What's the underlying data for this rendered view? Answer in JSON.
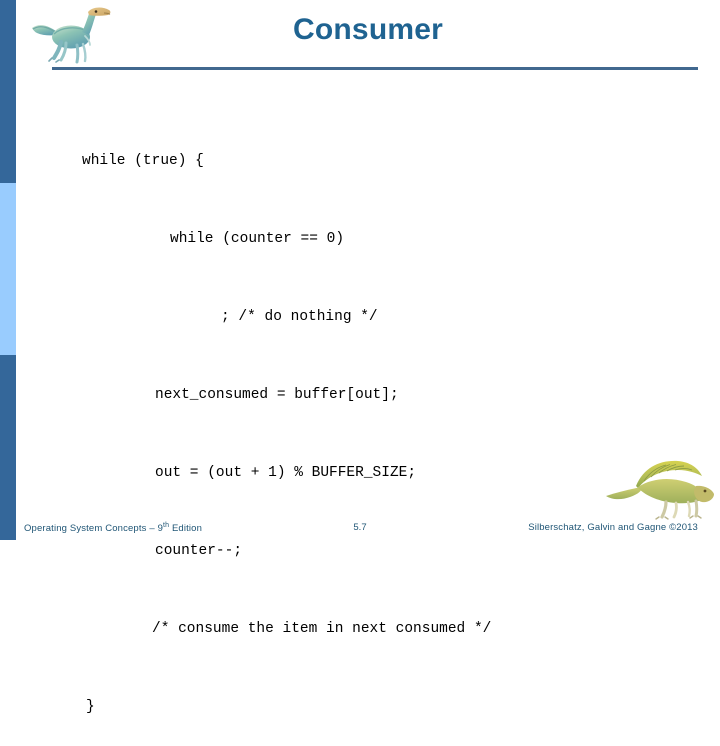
{
  "slide": {
    "title": "Consumer",
    "accent_color": "#1f6391",
    "rule_color": "#41688f",
    "sidebar_dark_color": "#34679a",
    "sidebar_light_color": "#99ccfe",
    "background_color": "#ffffff"
  },
  "logo": {
    "name": "dinosaur-logo",
    "alt": "Green ornithomimid dinosaur logo"
  },
  "code": {
    "lines": [
      "while (true) {",
      "while (counter == 0)",
      "; /* do nothing */",
      "next_consumed = buffer[out];",
      "out = (out + 1) % BUFFER_SIZE;",
      "counter--;",
      "/* consume the item in next consumed */",
      "}"
    ]
  },
  "footer_dino": {
    "name": "dimetrodon-decoration",
    "alt": "Yellow-green sailback dinosaur decoration"
  },
  "footer": {
    "book_title": "Operating System Concepts – 9",
    "edition_superscript": "th",
    "edition_suffix": " Edition",
    "page_number": "5.7",
    "copyright": "Silberschatz, Galvin and Gagne ©2013",
    "text_color": "#1f5575"
  }
}
